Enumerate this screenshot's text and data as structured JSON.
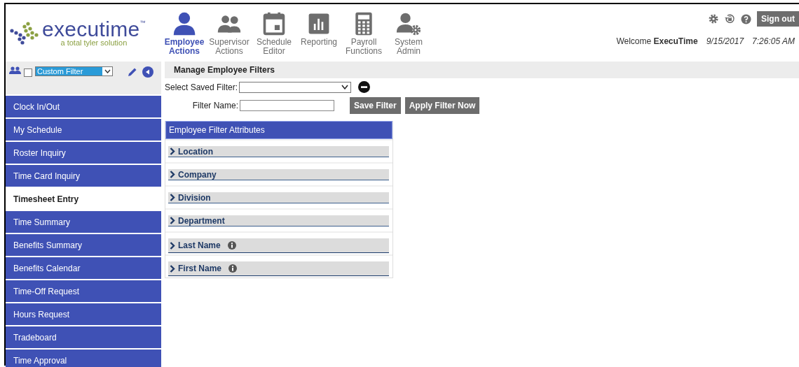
{
  "logo": {
    "name": "executime",
    "tm": "™",
    "tagline": "a total tyler solution"
  },
  "nav": [
    {
      "label": "Employee Actions",
      "kind": "person",
      "selected": true
    },
    {
      "label": "Supervisor Actions",
      "kind": "people",
      "selected": false
    },
    {
      "label": "Schedule Editor",
      "kind": "calendar",
      "selected": false
    },
    {
      "label": "Reporting",
      "kind": "chart",
      "selected": false
    },
    {
      "label": "Payroll Functions",
      "kind": "calculator",
      "selected": false
    },
    {
      "label": "System Admin",
      "kind": "admin",
      "selected": false
    }
  ],
  "user": {
    "sign_out": "Sign out",
    "welcome": "Welcome",
    "name": "ExecuTime",
    "date": "9/15/2017",
    "time": "7:26:05 AM"
  },
  "sidebar": {
    "filter_checked": false,
    "filter": "Custom Filter",
    "items": [
      {
        "label": "Clock In/Out",
        "selected": false
      },
      {
        "label": "My Schedule",
        "selected": false
      },
      {
        "label": "Roster Inquiry",
        "selected": false
      },
      {
        "label": "Time Card Inquiry",
        "selected": false
      },
      {
        "label": "Timesheet Entry",
        "selected": true
      },
      {
        "label": "Time Summary",
        "selected": false
      },
      {
        "label": "Benefits Summary",
        "selected": false
      },
      {
        "label": "Benefits Calendar",
        "selected": false
      },
      {
        "label": "Time-Off Request",
        "selected": false
      },
      {
        "label": "Hours Request",
        "selected": false
      },
      {
        "label": "Tradeboard",
        "selected": false
      },
      {
        "label": "Time Approval",
        "selected": false
      }
    ]
  },
  "main": {
    "title": "Manage Employee Filters",
    "saved_filter_label": "Select Saved Filter:",
    "filter_name_label": "Filter Name:",
    "buttons": [
      "Save Filter",
      "Apply Filter Now"
    ],
    "attributes_title": "Employee Filter Attributes",
    "attributes": [
      {
        "label": "Location",
        "info": false
      },
      {
        "label": "Company",
        "info": false
      },
      {
        "label": "Division",
        "info": false
      },
      {
        "label": "Department",
        "info": false
      },
      {
        "label": "Last Name",
        "info": true
      },
      {
        "label": "First Name",
        "info": true
      }
    ]
  }
}
